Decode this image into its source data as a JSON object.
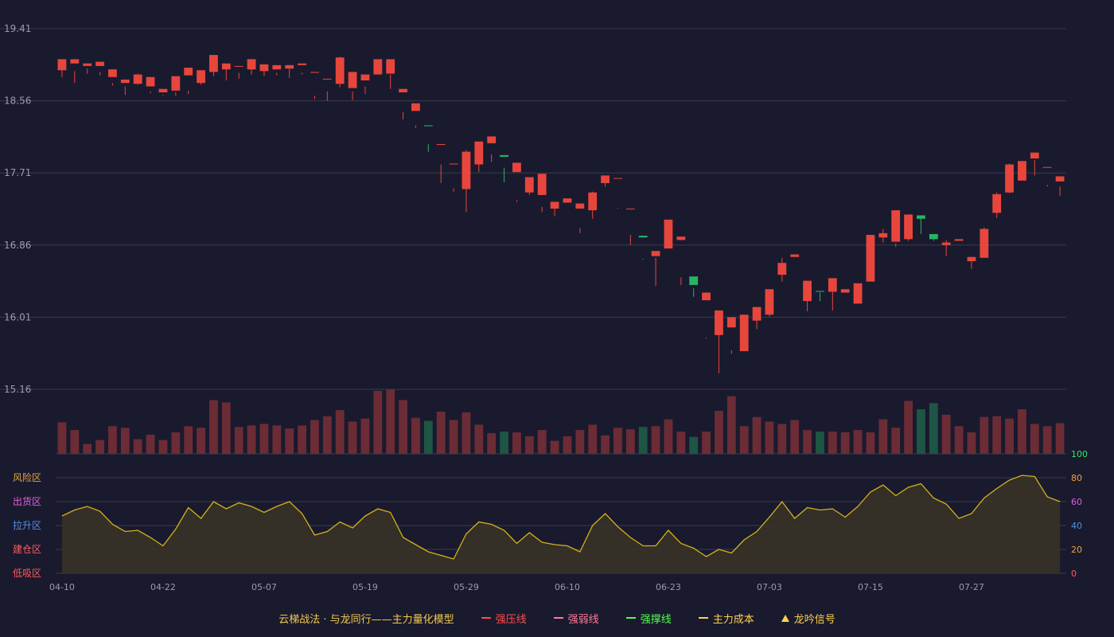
{
  "colors": {
    "background": "#1a1a2e",
    "grid": "#3a3a4c",
    "axis_text": "#9a9ab0",
    "up": "#e8463c",
    "down": "#26b466",
    "up_volume": "#6b2c35",
    "down_volume": "#1e5545",
    "indicator_line": "#d4b21a",
    "indicator_fill": "#3a3426",
    "risk": "#e8a33c",
    "distribution": "#e060e0",
    "rally": "#4f8fe8",
    "build": "#ff5a5a",
    "accumulate": "#ff5a5a",
    "right_100": "#2ee86a",
    "right_80": "#e8a33c",
    "right_60": "#e060e0",
    "right_40": "#4f8fe8",
    "right_20": "#e8a33c",
    "right_0": "#ff5a5a"
  },
  "price_axis": {
    "ticks": [
      "19.41",
      "18.56",
      "17.71",
      "16.86",
      "16.01",
      "15.16"
    ],
    "range": [
      15.16,
      19.41
    ]
  },
  "x_axis": {
    "labels": [
      {
        "i": 0,
        "label": "04-10"
      },
      {
        "i": 8,
        "label": "04-22"
      },
      {
        "i": 16,
        "label": "05-07"
      },
      {
        "i": 24,
        "label": "05-19"
      },
      {
        "i": 32,
        "label": "05-29"
      },
      {
        "i": 40,
        "label": "06-10"
      },
      {
        "i": 48,
        "label": "06-23"
      },
      {
        "i": 56,
        "label": "07-03"
      },
      {
        "i": 64,
        "label": "07-15"
      },
      {
        "i": 72,
        "label": "07-27"
      }
    ]
  },
  "indicator": {
    "zones": [
      {
        "label": "风险区",
        "value": 80,
        "color_key": "risk"
      },
      {
        "label": "出货区",
        "value": 60,
        "color_key": "distribution"
      },
      {
        "label": "拉升区",
        "value": 40,
        "color_key": "rally"
      },
      {
        "label": "建仓区",
        "value": 20,
        "color_key": "build"
      },
      {
        "label": "低吸区",
        "value": 0,
        "color_key": "accumulate"
      }
    ],
    "right_ticks": [
      {
        "label": "100",
        "value": 100,
        "color_key": "right_100"
      },
      {
        "label": "80",
        "value": 80,
        "color_key": "right_80"
      },
      {
        "label": "60",
        "value": 60,
        "color_key": "right_60"
      },
      {
        "label": "40",
        "value": 40,
        "color_key": "right_40"
      },
      {
        "label": "20",
        "value": 20,
        "color_key": "right_20"
      },
      {
        "label": "0",
        "value": 0,
        "color_key": "right_0"
      }
    ],
    "range": [
      0,
      100
    ]
  },
  "legend": {
    "title": "云梯战法 · 与龙同行——主力量化模型",
    "items": [
      {
        "label": "强压线",
        "color": "#ff4d4d",
        "style": "line"
      },
      {
        "label": "强弱线",
        "color": "#ff7a9a",
        "style": "dash"
      },
      {
        "label": "强撑线",
        "color": "#4dff4d",
        "style": "line"
      },
      {
        "label": "主力成本",
        "color": "#ffd24d",
        "style": "dash"
      },
      {
        "label": "龙吟信号",
        "color": "#ffd24d",
        "style": "triangle"
      }
    ],
    "title_color": "#f0c850"
  },
  "chart_data": {
    "type": "candlestick",
    "series": [
      {
        "name": "OHLC",
        "values": [
          [
            18.92,
            19.05,
            18.96,
            18.84
          ],
          [
            19.0,
            19.05,
            18.91,
            18.77
          ],
          [
            18.97,
            19.0,
            18.94,
            18.88
          ],
          [
            18.97,
            19.02,
            18.9,
            18.86
          ],
          [
            18.84,
            18.93,
            18.77,
            18.74
          ],
          [
            18.77,
            18.81,
            18.73,
            18.63
          ],
          [
            18.76,
            18.87,
            18.88,
            18.75
          ],
          [
            18.73,
            18.84,
            18.67,
            18.65
          ],
          [
            18.66,
            18.7,
            18.63,
            18.62
          ],
          [
            18.68,
            18.85,
            18.66,
            18.62
          ],
          [
            18.86,
            18.95,
            18.68,
            18.64
          ],
          [
            18.77,
            18.92,
            18.91,
            18.75
          ],
          [
            18.9,
            19.1,
            19.06,
            18.85
          ],
          [
            18.93,
            19.0,
            18.97,
            18.8
          ],
          [
            18.97,
            18.97,
            18.89,
            18.82
          ],
          [
            18.93,
            19.05,
            18.99,
            18.87
          ],
          [
            18.91,
            18.99,
            18.92,
            18.85
          ],
          [
            18.93,
            18.98,
            18.89,
            18.86
          ],
          [
            18.94,
            18.98,
            18.98,
            18.83
          ],
          [
            18.98,
            19.0,
            18.89,
            18.87
          ],
          [
            18.89,
            18.9,
            18.62,
            18.58
          ],
          [
            18.82,
            18.82,
            18.67,
            18.56
          ],
          [
            18.76,
            19.07,
            19.08,
            18.72
          ],
          [
            18.71,
            18.9,
            18.67,
            18.57
          ],
          [
            18.8,
            18.87,
            18.73,
            18.64
          ],
          [
            18.87,
            19.05,
            18.9,
            18.87
          ],
          [
            18.88,
            19.05,
            18.87,
            18.7
          ],
          [
            18.66,
            18.7,
            18.43,
            18.34
          ],
          [
            18.44,
            18.53,
            18.27,
            18.24
          ],
          [
            18.27,
            18.26,
            18.05,
            17.96
          ],
          [
            18.04,
            18.05,
            17.81,
            17.59
          ],
          [
            17.82,
            17.82,
            17.49,
            17.53
          ],
          [
            17.52,
            17.96,
            17.98,
            17.25
          ],
          [
            17.81,
            18.08,
            18.05,
            17.72
          ],
          [
            18.06,
            18.14,
            17.93,
            17.84
          ],
          [
            17.92,
            17.9,
            17.6,
            17.77
          ],
          [
            17.72,
            17.83,
            17.39,
            17.37
          ],
          [
            17.48,
            17.66,
            17.6,
            17.45
          ],
          [
            17.45,
            17.7,
            17.31,
            17.25
          ],
          [
            17.29,
            17.37,
            17.29,
            17.2
          ],
          [
            17.36,
            17.41,
            17.3,
            17.3
          ],
          [
            17.29,
            17.35,
            17.06,
            17.0
          ],
          [
            17.27,
            17.48,
            17.49,
            17.17
          ],
          [
            17.59,
            17.68,
            17.64,
            17.55
          ],
          [
            17.65,
            17.65,
            17.29,
            17.3
          ],
          [
            17.29,
            17.29,
            16.98,
            16.86
          ],
          [
            16.97,
            16.95,
            16.7,
            16.69
          ],
          [
            16.73,
            16.79,
            16.71,
            16.38
          ],
          [
            16.82,
            17.16,
            16.97,
            16.82
          ],
          [
            16.92,
            16.96,
            16.48,
            16.39
          ],
          [
            16.49,
            16.39,
            16.35,
            16.25
          ],
          [
            16.21,
            16.3,
            15.77,
            15.76
          ],
          [
            15.8,
            16.09,
            15.89,
            15.35
          ],
          [
            15.89,
            16.01,
            15.62,
            15.58
          ],
          [
            15.61,
            16.04,
            15.82,
            15.64
          ],
          [
            15.97,
            16.13,
            16.11,
            15.87
          ],
          [
            16.04,
            16.34,
            16.27,
            16.02
          ],
          [
            16.51,
            16.65,
            16.71,
            16.43
          ],
          [
            16.72,
            16.75,
            16.15,
            16.15
          ],
          [
            16.2,
            16.44,
            16.33,
            16.08
          ],
          [
            16.32,
            16.31,
            16.3,
            16.2
          ],
          [
            16.31,
            16.47,
            16.32,
            16.09
          ],
          [
            16.3,
            16.34,
            16.17,
            16.17
          ],
          [
            16.17,
            16.41,
            16.38,
            16.17
          ],
          [
            16.43,
            16.98,
            16.8,
            16.45
          ],
          [
            16.95,
            17.0,
            17.05,
            16.89
          ],
          [
            16.9,
            17.27,
            16.88,
            16.84
          ],
          [
            16.93,
            17.22,
            17.2,
            16.91
          ],
          [
            17.21,
            17.17,
            17.2,
            16.99
          ],
          [
            16.99,
            16.93,
            16.94,
            16.91
          ],
          [
            16.86,
            16.89,
            16.92,
            16.73
          ],
          [
            16.91,
            16.93,
            16.68,
            16.68
          ],
          [
            16.67,
            16.72,
            16.68,
            16.58
          ],
          [
            16.71,
            17.05,
            17.07,
            16.75
          ],
          [
            17.24,
            17.46,
            17.48,
            17.18
          ],
          [
            17.48,
            17.81,
            17.82,
            17.47
          ],
          [
            17.62,
            17.85,
            17.79,
            17.63
          ],
          [
            17.88,
            17.95,
            17.86,
            17.68
          ],
          [
            17.78,
            17.78,
            17.55,
            17.57
          ],
          [
            17.61,
            17.67,
            17.55,
            17.44
          ]
        ]
      },
      {
        "name": "Volume",
        "values": [
          41,
          31,
          13,
          18,
          36,
          34,
          19,
          25,
          18,
          28,
          36,
          34,
          70,
          67,
          35,
          37,
          39,
          37,
          33,
          37,
          44,
          49,
          57,
          42,
          46,
          82,
          84,
          70,
          47,
          43,
          55,
          44,
          54,
          38,
          27,
          29,
          28,
          23,
          31,
          17,
          23,
          31,
          38,
          24,
          34,
          32,
          35,
          36,
          45,
          29,
          22,
          29,
          56,
          75,
          36,
          48,
          42,
          39,
          44,
          31,
          29,
          29,
          28,
          31,
          28,
          45,
          34,
          69,
          58,
          66,
          51,
          36,
          28,
          48,
          49,
          46,
          58,
          39,
          36,
          40
        ]
      },
      {
        "name": "Indicator",
        "values": [
          48,
          53,
          56,
          52,
          41,
          35,
          36,
          30,
          23,
          37,
          55,
          46,
          60,
          54,
          59,
          56,
          51,
          56,
          60,
          50,
          32,
          35,
          43,
          38,
          48,
          54,
          51,
          30,
          24,
          18,
          15,
          12,
          33,
          43,
          41,
          36,
          25,
          34,
          26,
          24,
          23,
          18,
          40,
          50,
          39,
          30,
          23,
          23,
          36,
          25,
          21,
          14,
          20,
          17,
          28,
          35,
          47,
          60,
          46,
          55,
          53,
          54,
          47,
          56,
          68,
          74,
          65,
          72,
          75,
          63,
          58,
          46,
          50,
          63,
          71,
          78,
          82,
          81,
          64,
          60
        ]
      }
    ]
  }
}
